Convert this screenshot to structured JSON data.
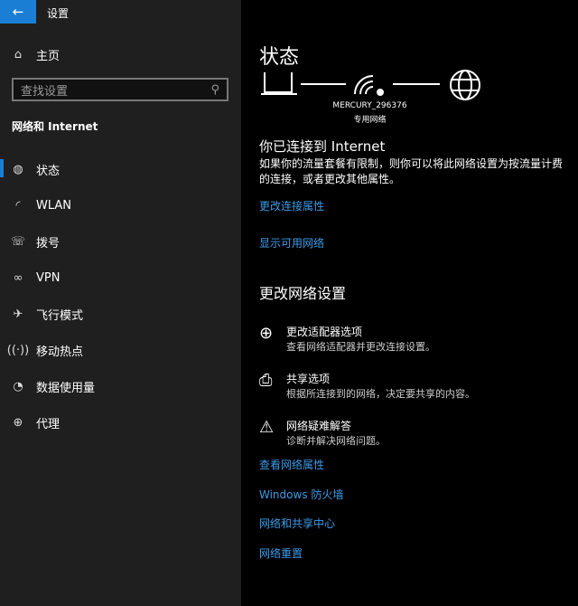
{
  "window": {
    "title": "设置",
    "back": "←"
  },
  "sidebar": {
    "home": "主页",
    "search_placeholder": "查找设置",
    "category": "网络和 Internet",
    "items": [
      {
        "label": "状态",
        "icon": "status-icon"
      },
      {
        "label": "WLAN",
        "icon": "wifi-icon"
      },
      {
        "label": "拨号",
        "icon": "dialup-icon"
      },
      {
        "label": "VPN",
        "icon": "vpn-icon"
      },
      {
        "label": "飞行模式",
        "icon": "airplane-icon"
      },
      {
        "label": "移动热点",
        "icon": "hotspot-icon"
      },
      {
        "label": "数据使用量",
        "icon": "data-usage-icon"
      },
      {
        "label": "代理",
        "icon": "globe-icon"
      }
    ]
  },
  "main": {
    "title": "状态",
    "network_name": "MERCURY_296376",
    "network_type": "专用网络",
    "connected_heading": "你已连接到 Internet",
    "connected_desc": "如果你的流量套餐有限制，则你可以将此网络设置为按流量计费的连接，或者更改其他属性。",
    "link_props": "更改连接属性",
    "link_available": "显示可用网络",
    "change_heading": "更改网络设置",
    "options": [
      {
        "title": "更改适配器选项",
        "desc": "查看网络适配器并更改连接设置。"
      },
      {
        "title": "共享选项",
        "desc": "根据所连接到的网络，决定要共享的内容。"
      },
      {
        "title": "网络疑难解答",
        "desc": "诊断并解决网络问题。"
      }
    ],
    "links": [
      "查看网络属性",
      "Windows 防火墙",
      "网络和共享中心",
      "网络重置"
    ]
  }
}
